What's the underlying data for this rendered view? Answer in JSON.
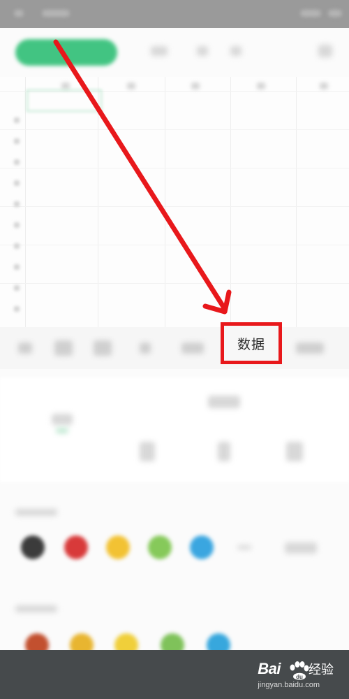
{
  "tabs": {
    "data_label": "数据"
  },
  "colors": {
    "accent_green": "#2fbf75",
    "highlight_red": "#e8181b",
    "swatches": [
      "#3b3b3b",
      "#d83a3a",
      "#f2c233",
      "#86c95a",
      "#3aa6e0"
    ],
    "swatches_row2": [
      "#c2502f",
      "#e8b530",
      "#f0cf3a",
      "#7fc25a",
      "#37a7dd"
    ]
  },
  "watermark": {
    "brand": "Bai",
    "brand_suffix": "du",
    "brand_cn": "经验",
    "url": "jingyan.baidu.com"
  },
  "icons": {
    "arrow": "red-arrow-annotation",
    "paw": "baidu-paw-icon"
  }
}
